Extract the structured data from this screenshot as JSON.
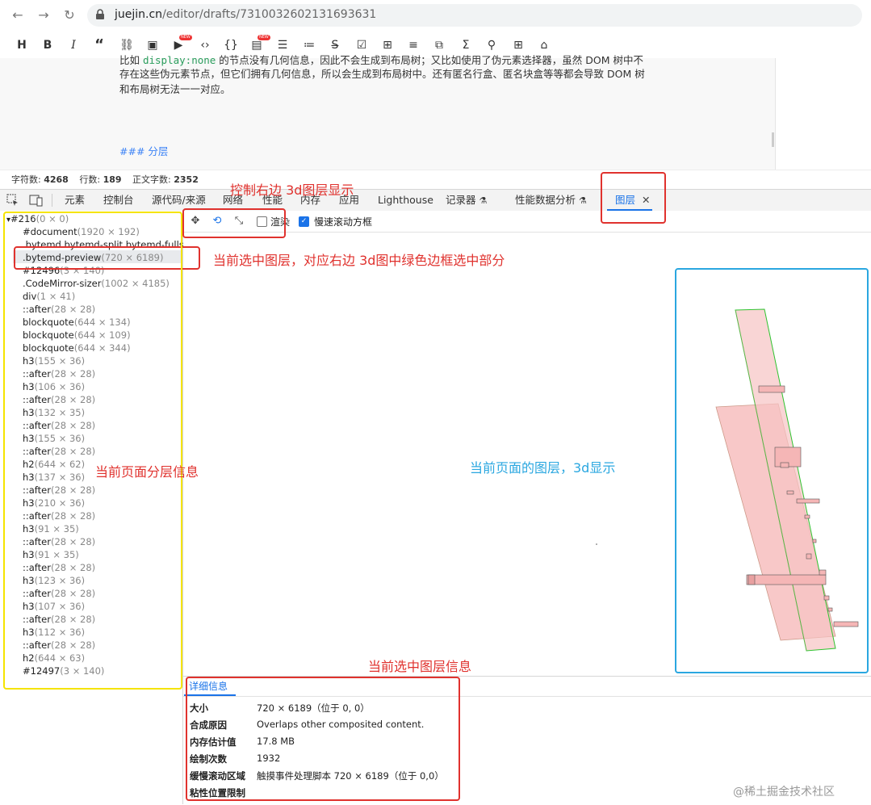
{
  "browser": {
    "url_host": "juejin.cn",
    "url_path": "/editor/drafts/7310032602131693631"
  },
  "editor_toolbar": {
    "items": [
      "H",
      "B",
      "I",
      "“",
      "link-icon",
      "image-icon",
      "video-icon",
      "code-icon",
      "braces-icon",
      "template-icon",
      "list-icon",
      "ordered-list-icon",
      "strike-icon",
      "checkbox-icon",
      "table-icon",
      "align-icon",
      "embed-icon",
      "sigma-icon",
      "tree-icon",
      "grid-icon",
      "bag-icon"
    ],
    "new_badge": "NEW"
  },
  "editor": {
    "line1_prefix": "比如 ",
    "line1_code": "display:none",
    "line1_suffix": " 的节点没有几何信息，因此不会生成到布局树；又比如使用了伪元素选择器，虽然 DOM 树中不",
    "line2": "存在这些伪元素节点，但它们拥有几何信息，所以会生成到布局树中。还有匿名行盒、匿名块盒等等都会导致 DOM 树",
    "line3": "和布局树无法一一对应。",
    "heading": "### 分层"
  },
  "status": {
    "chars_label": "字符数:",
    "chars": "4268",
    "lines_label": "行数:",
    "lines": "189",
    "body_label": "正文字数:",
    "body": "2352"
  },
  "devtools_tabs": [
    "元素",
    "控制台",
    "源代码/来源",
    "网络",
    "性能",
    "内存",
    "应用",
    "Lighthouse",
    "记录器",
    "性能数据分析",
    "图层"
  ],
  "layer_tree": [
    {
      "name": "#216",
      "dim": "(0 × 0)"
    },
    {
      "name": "#document",
      "dim": "(1920 × 192)"
    },
    {
      "name": ".bytemd.bytemd-split.bytemd-fullscr",
      "dim": ""
    },
    {
      "name": ".bytemd-preview",
      "dim": "(720 × 6189)"
    },
    {
      "name": "#12496",
      "dim": "(3 × 140)"
    },
    {
      "name": ".CodeMirror-sizer",
      "dim": "(1002 × 4185)"
    },
    {
      "name": "div",
      "dim": "(1 × 41)"
    },
    {
      "name": "::after",
      "dim": "(28 × 28)"
    },
    {
      "name": "blockquote",
      "dim": "(644 × 134)"
    },
    {
      "name": "blockquote",
      "dim": "(644 × 109)"
    },
    {
      "name": "blockquote",
      "dim": "(644 × 344)"
    },
    {
      "name": "h3",
      "dim": "(155 × 36)"
    },
    {
      "name": "::after",
      "dim": "(28 × 28)"
    },
    {
      "name": "h3",
      "dim": "(106 × 36)"
    },
    {
      "name": "::after",
      "dim": "(28 × 28)"
    },
    {
      "name": "h3",
      "dim": "(132 × 35)"
    },
    {
      "name": "::after",
      "dim": "(28 × 28)"
    },
    {
      "name": "h3",
      "dim": "(155 × 36)"
    },
    {
      "name": "::after",
      "dim": "(28 × 28)"
    },
    {
      "name": "h2",
      "dim": "(644 × 62)"
    },
    {
      "name": "h3",
      "dim": "(137 × 36)"
    },
    {
      "name": "::after",
      "dim": "(28 × 28)"
    },
    {
      "name": "h3",
      "dim": "(210 × 36)"
    },
    {
      "name": "::after",
      "dim": "(28 × 28)"
    },
    {
      "name": "h3",
      "dim": "(91 × 35)"
    },
    {
      "name": "::after",
      "dim": "(28 × 28)"
    },
    {
      "name": "h3",
      "dim": "(91 × 35)"
    },
    {
      "name": "::after",
      "dim": "(28 × 28)"
    },
    {
      "name": "h3",
      "dim": "(123 × 36)"
    },
    {
      "name": "::after",
      "dim": "(28 × 28)"
    },
    {
      "name": "h3",
      "dim": "(107 × 36)"
    },
    {
      "name": "::after",
      "dim": "(28 × 28)"
    },
    {
      "name": "h3",
      "dim": "(112 × 36)"
    },
    {
      "name": "::after",
      "dim": "(28 × 28)"
    },
    {
      "name": "h2",
      "dim": "(644 × 63)"
    },
    {
      "name": "#12497",
      "dim": "(3 × 140)"
    }
  ],
  "layer_toolbar": {
    "paint_label": "渲染",
    "paint_checked": false,
    "slow_scroll_label": "慢速滚动方框",
    "slow_scroll_checked": true
  },
  "details": {
    "tab": "详细信息",
    "rows": [
      {
        "key": "大小",
        "value": "720 × 6189（位于 0, 0）"
      },
      {
        "key": "合成原因",
        "value": "Overlaps other composited content."
      },
      {
        "key": "内存估计值",
        "value": "17.8 MB"
      },
      {
        "key": "绘制次数",
        "value": "1932"
      },
      {
        "key": "缓慢滚动区域",
        "value": "触摸事件处理脚本 720 × 6189（位于 0,0）"
      },
      {
        "key": "粘性位置限制",
        "value": ""
      }
    ]
  },
  "annotations": {
    "toolbar_note": "控制右边 3d图层显示",
    "selected_note": "当前选中图层，对应右边 3d图中绿色边框选中部分",
    "tree_note": "当前页面分层信息",
    "view_note": "当前页面的图层，3d显示",
    "details_note": "当前选中图层信息",
    "red": "#e0322e",
    "blue": "#2aa7e0",
    "yellow": "#f5e400"
  },
  "watermark": "@稀土掘金技术社区"
}
